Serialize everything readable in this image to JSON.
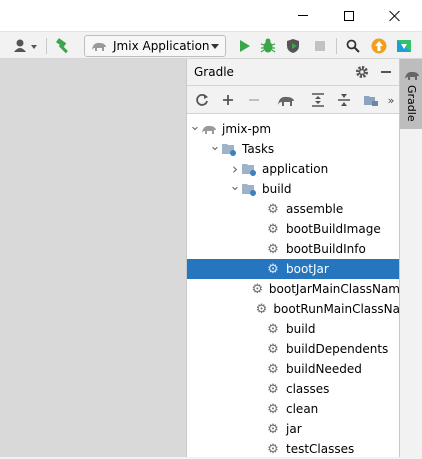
{
  "toolbar": {
    "run_config_label": "Jmix Application",
    "icons": [
      "user-icon",
      "hammer-icon",
      "run-icon",
      "debug-icon",
      "coverage-icon",
      "stop-icon",
      "search-icon",
      "update-icon",
      "toolbox-icon"
    ]
  },
  "gradle": {
    "title": "Gradle",
    "strip_label": "Gradle",
    "tree": {
      "project": "jmix-pm",
      "tasks": "Tasks",
      "groups": [
        {
          "label": "application",
          "expanded": false
        },
        {
          "label": "build",
          "expanded": true
        }
      ],
      "build_tasks": [
        "assemble",
        "bootBuildImage",
        "bootBuildInfo",
        "bootJar",
        "bootJarMainClassNam",
        "bootRunMainClassNa",
        "build",
        "buildDependents",
        "buildNeeded",
        "classes",
        "clean",
        "jar",
        "testClasses"
      ],
      "selected_task": "bootJar"
    }
  },
  "colors": {
    "selection": "#2675bf",
    "run_green": "#3aa64a",
    "update_orange": "#f0a01e"
  }
}
